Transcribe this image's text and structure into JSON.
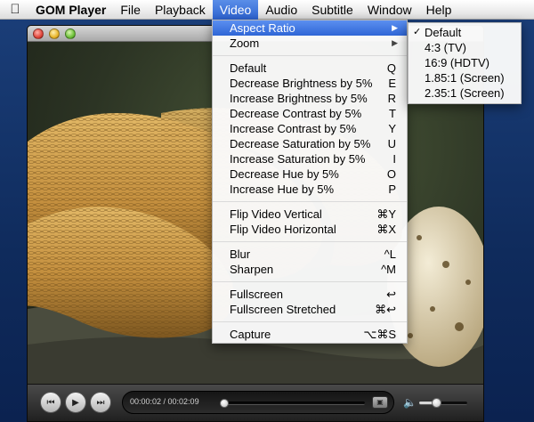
{
  "menubar": {
    "app_name": "GOM Player",
    "items": [
      "File",
      "Playback",
      "Video",
      "Audio",
      "Subtitle",
      "Window",
      "Help"
    ]
  },
  "video_menu": {
    "aspect_ratio": "Aspect Ratio",
    "zoom": "Zoom",
    "adjust": [
      {
        "label": "Default",
        "shortcut": "Q"
      },
      {
        "label": "Decrease Brightness by 5%",
        "shortcut": "E"
      },
      {
        "label": "Increase Brightness by 5%",
        "shortcut": "R"
      },
      {
        "label": "Decrease Contrast by 5%",
        "shortcut": "T"
      },
      {
        "label": "Increase Contrast by 5%",
        "shortcut": "Y"
      },
      {
        "label": "Decrease Saturation by 5%",
        "shortcut": "U"
      },
      {
        "label": "Increase Saturation by 5%",
        "shortcut": "I"
      },
      {
        "label": "Decrease Hue by 5%",
        "shortcut": "O"
      },
      {
        "label": "Increase Hue by 5%",
        "shortcut": "P"
      }
    ],
    "flip": [
      {
        "label": "Flip Video Vertical",
        "shortcut": "⌘Y"
      },
      {
        "label": "Flip Video Horizontal",
        "shortcut": "⌘X"
      }
    ],
    "filters": [
      {
        "label": "Blur",
        "shortcut": "^L"
      },
      {
        "label": "Sharpen",
        "shortcut": "^M"
      }
    ],
    "fullscreen": [
      {
        "label": "Fullscreen",
        "shortcut": "↩"
      },
      {
        "label": "Fullscreen Stretched",
        "shortcut": "⌘↩"
      }
    ],
    "capture": {
      "label": "Capture",
      "shortcut": "⌥⌘S"
    }
  },
  "aspect_submenu": {
    "items": [
      "Default",
      "4:3 (TV)",
      "16:9 (HDTV)",
      "1.85:1 (Screen)",
      "2.35:1 (Screen)"
    ],
    "checked_index": 0
  },
  "player": {
    "time": "00:00:02 / 00:02:09",
    "seek_fraction": 0.015,
    "volume_fraction": 0.35
  },
  "colors": {
    "menu_highlight": "#2f66d6",
    "desktop": "#1b3f7a"
  }
}
